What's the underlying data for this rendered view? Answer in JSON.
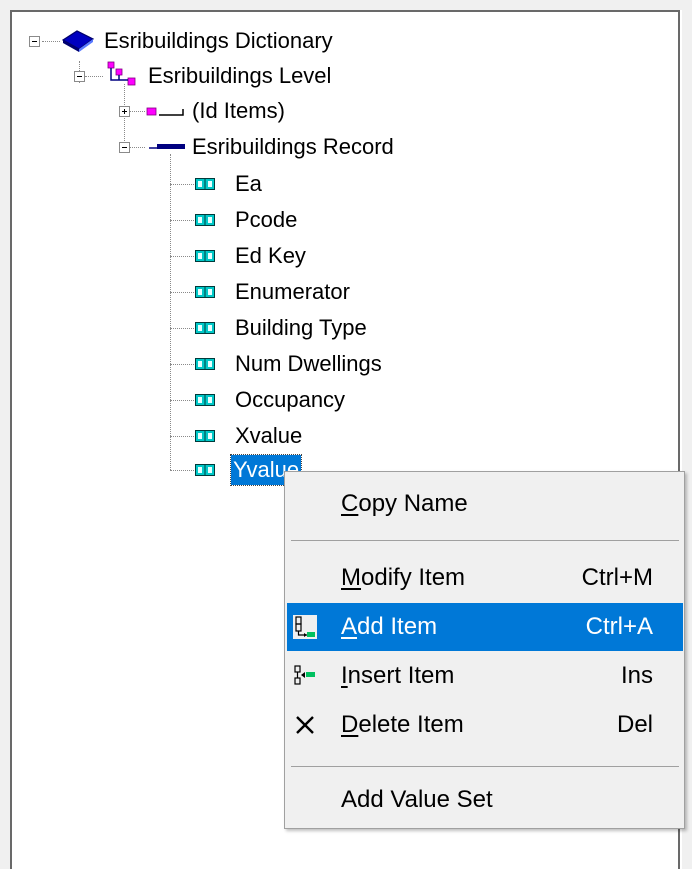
{
  "tree": {
    "dictionary": {
      "label": "Esribuildings Dictionary"
    },
    "level": {
      "label": "Esribuildings Level"
    },
    "id_items": {
      "label": "(Id Items)"
    },
    "record": {
      "label": "Esribuildings Record"
    },
    "items": [
      {
        "label": "Ea"
      },
      {
        "label": "Pcode"
      },
      {
        "label": "Ed Key"
      },
      {
        "label": "Enumerator"
      },
      {
        "label": "Building Type"
      },
      {
        "label": "Num Dwellings"
      },
      {
        "label": "Occupancy"
      },
      {
        "label": "Xvalue"
      },
      {
        "label": "Yvalue",
        "selected": true
      }
    ]
  },
  "context_menu": {
    "copy_name": {
      "pre": "",
      "acc": "C",
      "post": "opy Name"
    },
    "modify_item": {
      "pre": "",
      "acc": "M",
      "post": "odify Item",
      "shortcut": "Ctrl+M"
    },
    "add_item": {
      "pre": "",
      "acc": "A",
      "post": "dd Item",
      "shortcut": "Ctrl+A",
      "highlighted": true
    },
    "insert_item": {
      "pre": "",
      "acc": "I",
      "post": "nsert Item",
      "shortcut": "Ins"
    },
    "delete_item": {
      "pre": "",
      "acc": "D",
      "post": "elete Item",
      "shortcut": "Del"
    },
    "add_value_set": {
      "label": "Add Value Set"
    }
  },
  "colors": {
    "selection": "#0078d7",
    "item_icon": "#00c8c8",
    "level_icon": "#ff00ff",
    "record_icon": "#000080",
    "dictionary_icon": "#0000c0"
  },
  "icons": {
    "dictionary": "book-icon",
    "level": "level-icon",
    "id_items": "id-items-icon",
    "record": "record-icon",
    "item": "item-icon",
    "add_item": "add-item-icon",
    "insert_item": "insert-item-icon",
    "delete_item": "delete-x-icon"
  }
}
